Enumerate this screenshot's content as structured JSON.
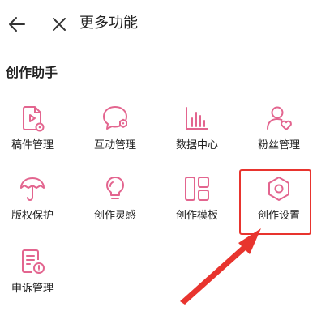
{
  "header": {
    "title": "更多功能",
    "back_icon": "arrow-left-icon",
    "close_icon": "close-icon"
  },
  "section": {
    "title": "创作助手"
  },
  "tools": [
    {
      "label": "稿件管理",
      "icon": "manuscript-icon"
    },
    {
      "label": "互动管理",
      "icon": "chat-bubble-icon"
    },
    {
      "label": "数据中心",
      "icon": "bar-chart-icon"
    },
    {
      "label": "粉丝管理",
      "icon": "fan-user-icon"
    },
    {
      "label": "版权保护",
      "icon": "umbrella-icon"
    },
    {
      "label": "创作灵感",
      "icon": "lightbulb-icon"
    },
    {
      "label": "创作模板",
      "icon": "template-grid-icon"
    },
    {
      "label": "创作设置",
      "icon": "hexagon-settings-icon"
    },
    {
      "label": "申诉管理",
      "icon": "appeal-doc-icon"
    }
  ],
  "colors": {
    "icon_accent": "#e3658f",
    "highlight": "#e8342e"
  }
}
